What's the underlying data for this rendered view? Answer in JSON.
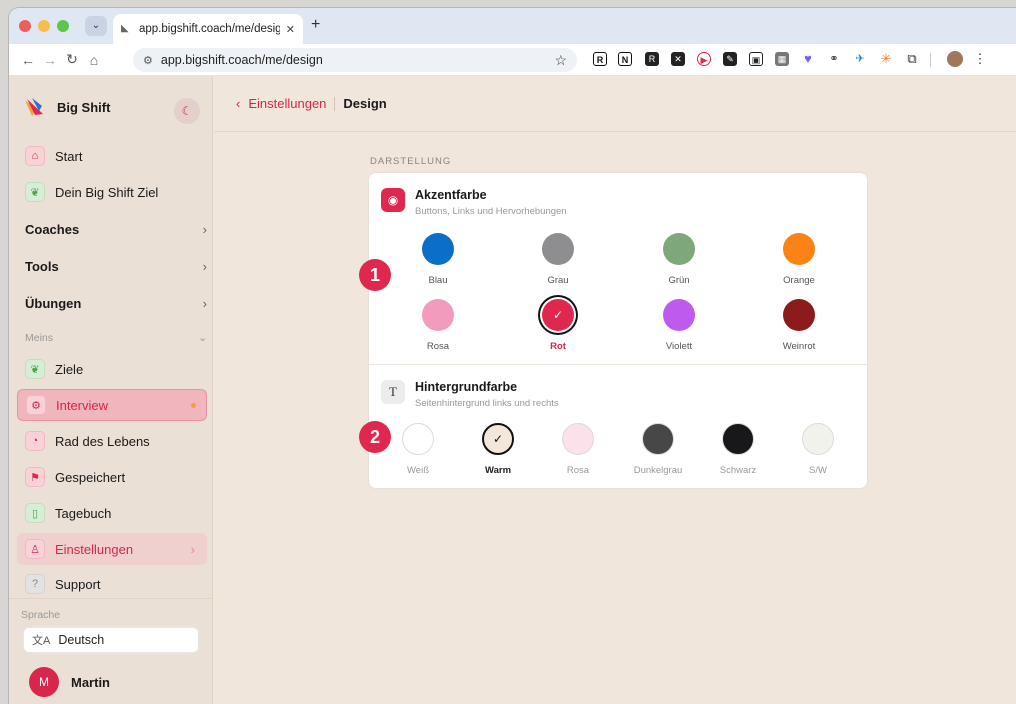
{
  "browser": {
    "tab_title": "app.bigshift.coach/me/design",
    "url": "app.bigshift.coach/me/design"
  },
  "sidebar": {
    "brand": "Big Shift",
    "top_items": [
      {
        "label": "Start",
        "icon": "home-icon"
      },
      {
        "label": "Dein Big Shift Ziel",
        "icon": "leaf-icon"
      }
    ],
    "sections": [
      {
        "label": "Coaches"
      },
      {
        "label": "Tools"
      },
      {
        "label": "Übungen"
      }
    ],
    "group_label": "Meins",
    "items": [
      {
        "label": "Ziele",
        "icon": "leaf-icon"
      },
      {
        "label": "Interview",
        "icon": "gear-icon"
      },
      {
        "label": "Rad des Lebens",
        "icon": "pie-icon"
      },
      {
        "label": "Gespeichert",
        "icon": "bookmark-icon"
      },
      {
        "label": "Tagebuch",
        "icon": "book-icon"
      },
      {
        "label": "Einstellungen",
        "icon": "user-icon"
      },
      {
        "label": "Support",
        "icon": "help-icon"
      }
    ],
    "language_label": "Sprache",
    "language_value": "Deutsch",
    "user_initial": "M",
    "user_name": "Martin"
  },
  "header": {
    "back_label": "Einstellungen",
    "title": "Design"
  },
  "section_label": "DARSTELLUNG",
  "accent": {
    "title": "Akzentfarbe",
    "subtitle": "Buttons, Links und Hervorhebungen",
    "colors": [
      {
        "label": "Blau",
        "hex": "#0b6fca"
      },
      {
        "label": "Grau",
        "hex": "#8e8e90"
      },
      {
        "label": "Grün",
        "hex": "#7fa77c"
      },
      {
        "label": "Orange",
        "hex": "#fb8214"
      },
      {
        "label": "Rosa",
        "hex": "#f29bbd"
      },
      {
        "label": "Rot",
        "hex": "#e0284e",
        "selected": true
      },
      {
        "label": "Violett",
        "hex": "#be5bee"
      },
      {
        "label": "Weinrot",
        "hex": "#8c1c1c"
      }
    ]
  },
  "background": {
    "title": "Hintergrundfarbe",
    "subtitle": "Seitenhintergrund links und rechts",
    "colors": [
      {
        "label": "Weiß",
        "hex": "#ffffff"
      },
      {
        "label": "Warm",
        "hex": "#f3e6da",
        "selected": true
      },
      {
        "label": "Rosa",
        "hex": "#fae1ea"
      },
      {
        "label": "Dunkelgrau",
        "hex": "#474747"
      },
      {
        "label": "Schwarz",
        "hex": "#18181b"
      },
      {
        "label": "S/W",
        "hex": "#f2f2ec"
      }
    ]
  },
  "annotations": [
    "1",
    "2"
  ],
  "colors": {
    "accent": "#d9264b",
    "sidebar_bg": "#eae0d5",
    "page_bg": "#f0e6dc"
  }
}
